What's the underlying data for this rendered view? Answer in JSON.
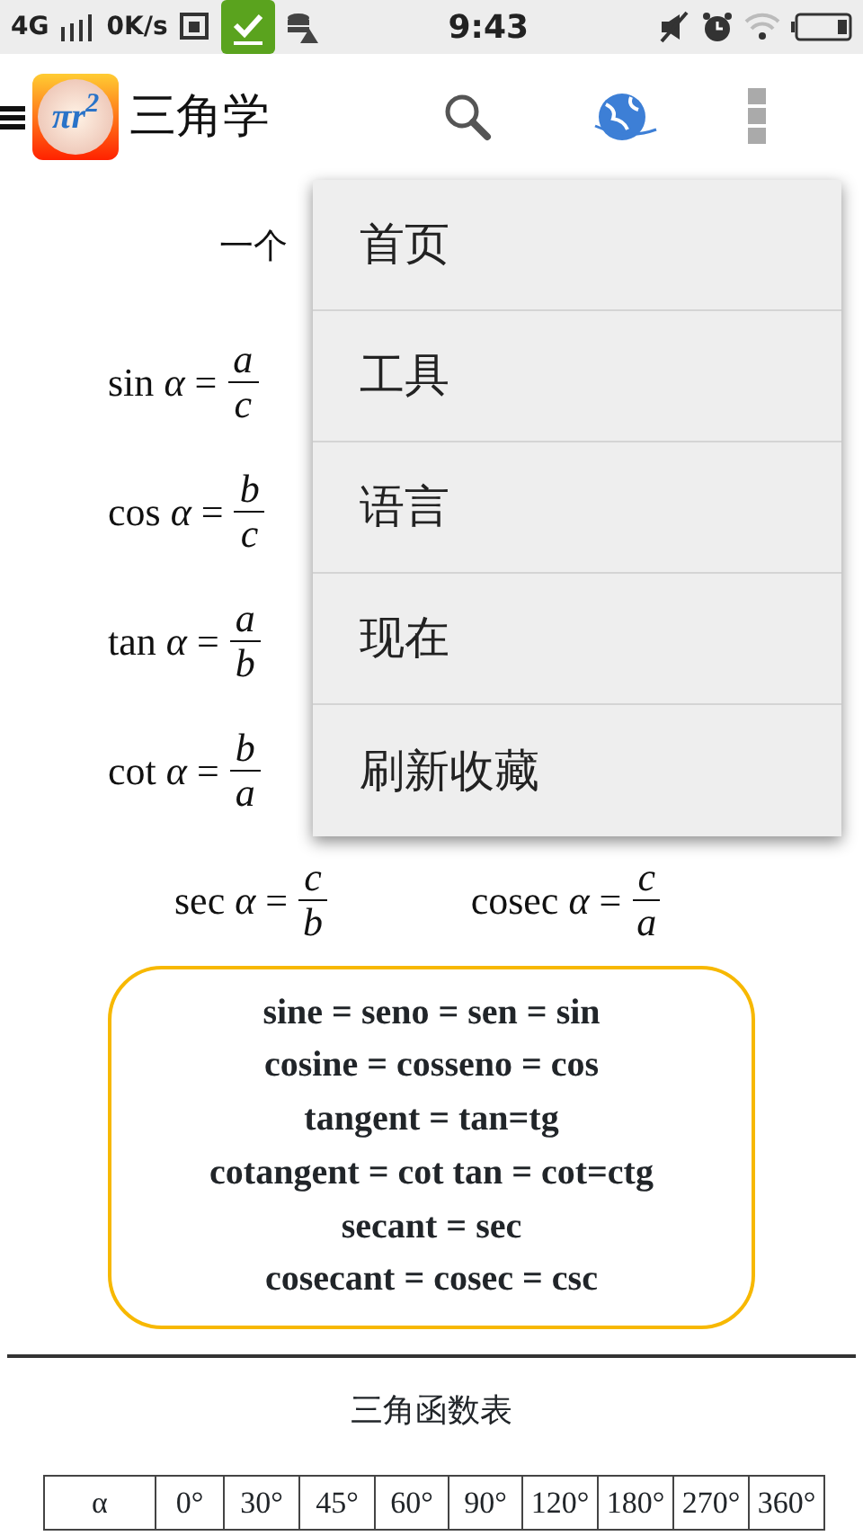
{
  "status_bar": {
    "network": "4G",
    "speed": "0K/s",
    "time": "9:43"
  },
  "app_bar": {
    "logo_text": "πr$^{2}$",
    "title": "三角学"
  },
  "menu": {
    "items": [
      {
        "label": "首页"
      },
      {
        "label": "工具"
      },
      {
        "label": "语言"
      },
      {
        "label": "现在"
      },
      {
        "label": "刷新收藏"
      }
    ]
  },
  "intro": "一个",
  "formulas": [
    {
      "lhs": "sin *α* =",
      "numerator": "a",
      "denominator": "c"
    },
    {
      "lhs": "cos *α* =",
      "numerator": "b",
      "denominator": "c"
    },
    {
      "lhs": "tan *α* =",
      "numerator": "a",
      "denominator": "b"
    },
    {
      "lhs": "cot *α* =",
      "numerator": "b",
      "denominator": "a"
    }
  ],
  "reciprocals": [
    {
      "lhs": "sec *α* =",
      "numerator": "c",
      "denominator": "b"
    },
    {
      "lhs": "cosec *α* =",
      "numerator": "c",
      "denominator": "a"
    }
  ],
  "synonyms": [
    "sine = seno = sen = sin",
    "cosine = cosseno = cos",
    "tangent = tan=tg",
    "cotangent = cot tan = cot=ctg",
    "secant = sec",
    "cosecant = cosec = csc"
  ],
  "table": {
    "title": "三角函数表",
    "rows": [
      [
        "α",
        "0°",
        "30°",
        "45°",
        "60°",
        "90°",
        "120°",
        "180°",
        "270°",
        "360°"
      ]
    ]
  }
}
